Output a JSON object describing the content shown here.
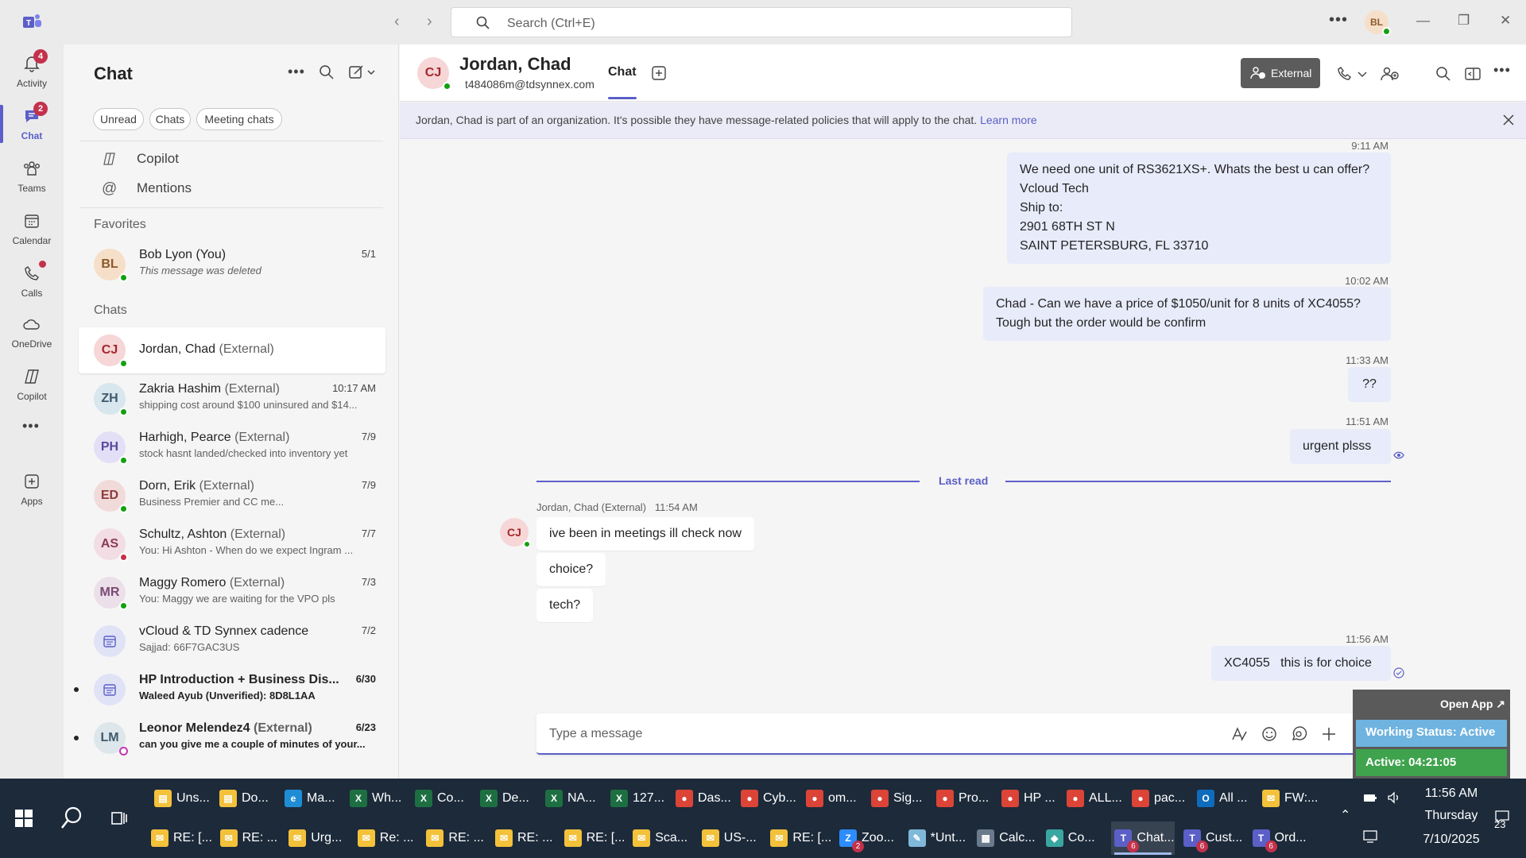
{
  "titlebar": {
    "search_placeholder": "Search (Ctrl+E)",
    "me_initials": "BL"
  },
  "apprail": {
    "items": [
      {
        "label": "Activity",
        "icon": "bell-icon",
        "badge": "4"
      },
      {
        "label": "Chat",
        "icon": "chat-icon",
        "badge": "2"
      },
      {
        "label": "Teams",
        "icon": "teams-icon"
      },
      {
        "label": "Calendar",
        "icon": "calendar-icon"
      },
      {
        "label": "Calls",
        "icon": "phone-icon"
      },
      {
        "label": "OneDrive",
        "icon": "cloud-icon"
      },
      {
        "label": "Copilot",
        "icon": "copilot-icon"
      },
      {
        "label": "Apps",
        "icon": "add-app-icon"
      }
    ]
  },
  "chatlist": {
    "title": "Chat",
    "filters": [
      "Unread",
      "Chats",
      "Meeting chats"
    ],
    "links": [
      "Copilot",
      "Mentions"
    ],
    "favorites_label": "Favorites",
    "chats_label": "Chats",
    "favorites": [
      {
        "initials": "BL",
        "name": "Bob Lyon (You)",
        "preview": "This message was deleted",
        "date": "5/1"
      }
    ],
    "chats": [
      {
        "initials": "CJ",
        "name": "Jordan, Chad",
        "ext": "(External)",
        "date": "",
        "preview": ""
      },
      {
        "initials": "ZH",
        "name": "Zakria Hashim",
        "ext": "(External)",
        "date": "10:17 AM",
        "preview": "shipping cost around $100 uninsured and $14..."
      },
      {
        "initials": "PH",
        "name": "Harhigh, Pearce",
        "ext": "(External)",
        "date": "7/9",
        "preview": "stock hasnt landed/checked into inventory yet"
      },
      {
        "initials": "ED",
        "name": "Dorn, Erik",
        "ext": "(External)",
        "date": "7/9",
        "preview": "Business Premier and CC me..."
      },
      {
        "initials": "AS",
        "name": "Schultz, Ashton",
        "ext": "(External)",
        "date": "7/7",
        "preview": "You: Hi Ashton -  When do we expect Ingram ..."
      },
      {
        "initials": "MR",
        "name": "Maggy Romero",
        "ext": "(External)",
        "date": "7/3",
        "preview": "You: Maggy we are waiting for the VPO pls"
      },
      {
        "initials": "",
        "name": "vCloud & TD Synnex cadence",
        "ext": "",
        "date": "7/2",
        "preview": "Sajjad: 66F7GAC3US"
      },
      {
        "initials": "",
        "name": "HP Introduction + Business Dis...",
        "ext": "",
        "date": "6/30",
        "preview": "Waleed Ayub (Unverified): 8D8L1AA"
      },
      {
        "initials": "LM",
        "name": "Leonor Melendez4",
        "ext": "(External)",
        "date": "6/23",
        "preview": "can you give me a couple of minutes of your..."
      }
    ]
  },
  "header": {
    "initials": "CJ",
    "name": "Jordan, Chad",
    "email": "t484086m@tdsynnex.com",
    "tab": "Chat",
    "external_label": "External"
  },
  "banner": {
    "text": "Jordan, Chad is part of an organization. It's possible they have message-related policies that will apply to the chat.",
    "link": "Learn more"
  },
  "messages": {
    "m1_time": "9:11 AM",
    "m1_lines": [
      "We need one unit of RS3621XS+. Whats the best u can offer?",
      "Vcloud Tech",
      "Ship to:",
      "2901 68TH ST N",
      "SAINT PETERSBURG, FL 33710"
    ],
    "m2_time": "10:02 AM",
    "m2_lines": [
      "Chad -  Can we have a price of $1050/unit for 8 units of XC4055?",
      "Tough but the order would be confirm"
    ],
    "m3_time": "11:33 AM",
    "m3_text": "??",
    "m4_time": "11:51 AM",
    "m4_text": "urgent plsss",
    "last_read": "Last read",
    "sender": "Jordan, Chad (External)   11:54 AM",
    "sender_initials": "CJ",
    "r1": "ive been in meetings  ill check now",
    "r2": "choice?",
    "r3": "tech?",
    "m5_time": "11:56 AM",
    "m5_text": "XC4055   this is for choice"
  },
  "composer": {
    "placeholder": "Type a message"
  },
  "status_widget": {
    "open_app": "Open App ↗",
    "working_status": "Working Status: Active",
    "active_timer": "Active: 04:21:05"
  },
  "taskbar": {
    "row1": [
      {
        "label": "Uns...",
        "icon": "folder-icon",
        "color": "#f3c13a"
      },
      {
        "label": "Do...",
        "icon": "folder-icon",
        "color": "#f3c13a"
      },
      {
        "label": "Ma...",
        "icon": "edge-icon",
        "color": "#1f8dd6"
      },
      {
        "label": "Wh...",
        "icon": "excel-icon",
        "color": "#1d6f42"
      },
      {
        "label": "Co...",
        "icon": "excel-icon",
        "color": "#1d6f42"
      },
      {
        "label": "De...",
        "icon": "excel-icon",
        "color": "#1d6f42"
      },
      {
        "label": "NA...",
        "icon": "excel-icon",
        "color": "#1d6f42"
      },
      {
        "label": "127...",
        "icon": "excel-icon",
        "color": "#1d6f42"
      },
      {
        "label": "Das...",
        "icon": "chrome-icon",
        "color": "#db4437"
      },
      {
        "label": "Cyb...",
        "icon": "chrome-icon",
        "color": "#db4437"
      },
      {
        "label": "om...",
        "icon": "chrome-icon",
        "color": "#db4437"
      },
      {
        "label": "Sig...",
        "icon": "chrome-icon",
        "color": "#db4437"
      },
      {
        "label": "Pro...",
        "icon": "chrome-icon",
        "color": "#db4437"
      },
      {
        "label": "HP ...",
        "icon": "chrome-icon",
        "color": "#db4437"
      },
      {
        "label": "ALL...",
        "icon": "chrome-icon",
        "color": "#db4437"
      },
      {
        "label": "pac...",
        "icon": "chrome-icon",
        "color": "#db4437"
      },
      {
        "label": "All ...",
        "icon": "outlook-icon",
        "color": "#0f6cbd"
      },
      {
        "label": "FW:...",
        "icon": "mail-icon",
        "color": "#f3c13a"
      }
    ],
    "row2": [
      {
        "label": "RE: [...",
        "icon": "mail-icon",
        "color": "#f3c13a"
      },
      {
        "label": "RE: ...",
        "icon": "mail-icon",
        "color": "#f3c13a"
      },
      {
        "label": "Urg...",
        "icon": "mail-icon",
        "color": "#f3c13a"
      },
      {
        "label": "Re: ...",
        "icon": "mail-icon",
        "color": "#f3c13a"
      },
      {
        "label": "RE: ...",
        "icon": "mail-icon",
        "color": "#f3c13a"
      },
      {
        "label": "RE: ...",
        "icon": "mail-icon",
        "color": "#f3c13a"
      },
      {
        "label": "RE: [...",
        "icon": "mail-icon",
        "color": "#f3c13a"
      },
      {
        "label": "Sca...",
        "icon": "mail-icon",
        "color": "#f3c13a"
      },
      {
        "label": "US-...",
        "icon": "mail-icon",
        "color": "#f3c13a"
      },
      {
        "label": "RE: [...",
        "icon": "mail-icon",
        "color": "#f3c13a"
      },
      {
        "label": "Zoo...",
        "icon": "zoom-icon",
        "color": "#2d8cff",
        "num": "2"
      },
      {
        "label": "*Unt...",
        "icon": "notepad-icon",
        "color": "#7fb8d8"
      },
      {
        "label": "Calc...",
        "icon": "calculator-icon",
        "color": "#6b7b8c"
      },
      {
        "label": "Co...",
        "icon": "copilot-icon",
        "color": "#3aa6a0"
      },
      {
        "label": "Chat...",
        "icon": "teams-icon",
        "color": "#5b5fc7",
        "num": "6",
        "active": true
      },
      {
        "label": "Cust...",
        "icon": "teams-icon",
        "color": "#5b5fc7",
        "num": "6"
      },
      {
        "label": "Ord...",
        "icon": "teams-icon",
        "color": "#5b5fc7",
        "num": "6"
      }
    ],
    "clock_time": "11:56 AM",
    "clock_day": "Thursday",
    "clock_date": "7/10/2025",
    "notif_count": "23"
  },
  "colors": {
    "accent": "#5b5fc7",
    "bubble_me": "#e8ebfa",
    "presence_available": "#13a10e",
    "presence_busy": "#c4314b",
    "badge": "#c4314b"
  }
}
